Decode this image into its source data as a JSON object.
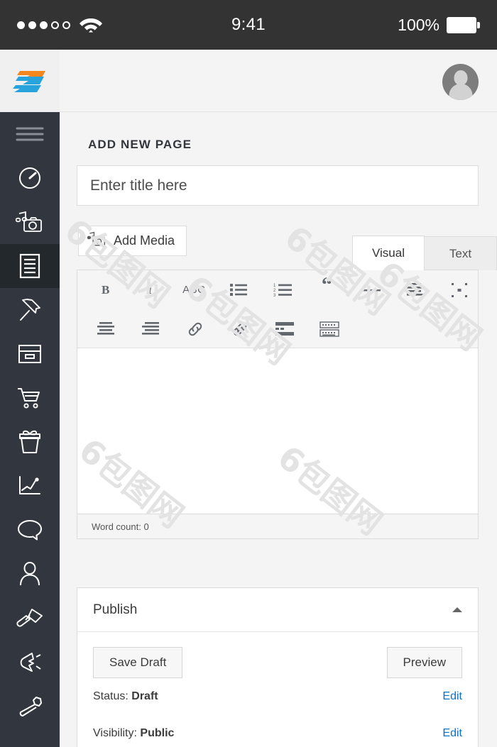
{
  "statusbar": {
    "signal_filled": 3,
    "signal_empty": 2,
    "wifi_icon": "wifi-icon",
    "time": "9:41",
    "battery_percent": "100%",
    "battery_icon": "battery-full-icon"
  },
  "topbar": {
    "logo_icon": "brand-logo-icon",
    "avatar_icon": "user-avatar-icon"
  },
  "sidebar": {
    "items": [
      {
        "icon": "hamburger-menu-icon",
        "label": "Menu",
        "active": false
      },
      {
        "icon": "dashboard-gauge-icon",
        "label": "Dashboard",
        "active": false
      },
      {
        "icon": "media-music-camera-icon",
        "label": "Media",
        "active": false
      },
      {
        "icon": "pages-document-icon",
        "label": "Pages",
        "active": true
      },
      {
        "icon": "pin-icon",
        "label": "Posts",
        "active": false
      },
      {
        "icon": "archive-box-icon",
        "label": "Archive",
        "active": false
      },
      {
        "icon": "shopping-cart-icon",
        "label": "Shop",
        "active": false
      },
      {
        "icon": "gift-box-icon",
        "label": "Products",
        "active": false
      },
      {
        "icon": "analytics-chart-icon",
        "label": "Analytics",
        "active": false
      },
      {
        "icon": "comment-bubble-icon",
        "label": "Comments",
        "active": false
      },
      {
        "icon": "user-profile-icon",
        "label": "Users",
        "active": false
      },
      {
        "icon": "paintbrush-icon",
        "label": "Appearance",
        "active": false
      },
      {
        "icon": "plug-icon",
        "label": "Plugins",
        "active": false
      },
      {
        "icon": "wrench-icon",
        "label": "Tools",
        "active": false
      }
    ]
  },
  "main": {
    "page_title": "ADD NEW PAGE",
    "title_placeholder": "Enter title here",
    "title_value": "",
    "add_media_label": "Add Media",
    "add_media_icon": "media-music-camera-icon",
    "tabs": [
      {
        "label": "Visual",
        "active": true
      },
      {
        "label": "Text",
        "active": false
      }
    ],
    "toolbar_row1": [
      {
        "icon": "bold-icon",
        "label": "B"
      },
      {
        "icon": "italic-icon",
        "label": "I"
      },
      {
        "icon": "strikethrough-icon",
        "label": "ABC"
      },
      {
        "icon": "bulleted-list-icon",
        "label": ""
      },
      {
        "icon": "numbered-list-icon",
        "label": ""
      },
      {
        "icon": "blockquote-icon",
        "label": "“"
      },
      {
        "icon": "horizontal-rule-icon",
        "label": ""
      },
      {
        "icon": "align-left-icon",
        "label": ""
      },
      {
        "icon": "fullscreen-icon",
        "label": ""
      }
    ],
    "toolbar_row2": [
      {
        "icon": "align-center-icon",
        "label": ""
      },
      {
        "icon": "align-right-icon",
        "label": ""
      },
      {
        "icon": "insert-link-icon",
        "label": ""
      },
      {
        "icon": "unlink-icon",
        "label": ""
      },
      {
        "icon": "read-more-icon",
        "label": ""
      },
      {
        "icon": "keyboard-shortcuts-icon",
        "label": ""
      }
    ],
    "editor_content": "",
    "word_count": "Word count: 0"
  },
  "publish": {
    "title": "Publish",
    "collapse_icon": "chevron-up-icon",
    "save_draft_label": "Save Draft",
    "preview_label": "Preview",
    "rows": [
      {
        "label": "Status:",
        "value": "Draft",
        "action": "Edit"
      },
      {
        "label": "Visibility:",
        "value": "Public",
        "action": "Edit"
      }
    ]
  },
  "watermark": {
    "text": "6包图网",
    "color": "#e3e3e3"
  },
  "colors": {
    "statusbar_bg": "#333333",
    "sidebar_bg": "#32373f",
    "sidebar_active_bg": "#23282d",
    "page_bg": "#f4f4f4",
    "link_blue": "#0b72c5",
    "logo_orange": "#f6871f",
    "logo_blue": "#29a3dc"
  }
}
